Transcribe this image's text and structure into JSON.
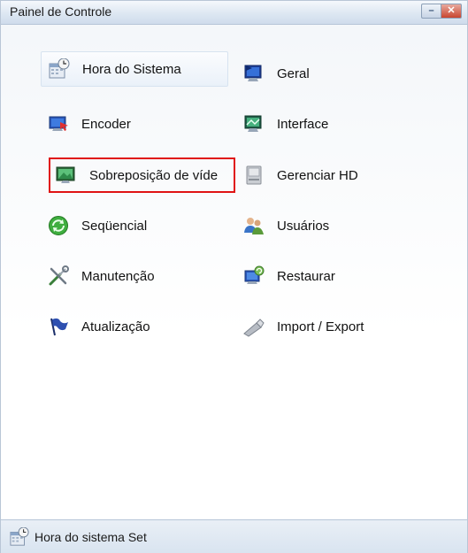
{
  "window": {
    "title": "Painel de Controle",
    "minimize_label": "–",
    "close_label": "✕"
  },
  "menu": {
    "left": [
      {
        "label": "Hora do Sistema",
        "icon": "calendar-clock-icon"
      },
      {
        "label": "Encoder",
        "icon": "monitor-arrow-icon"
      },
      {
        "label": "Sobreposição de víde",
        "icon": "video-overlay-icon"
      },
      {
        "label": "Seqüencial",
        "icon": "sequence-refresh-icon"
      },
      {
        "label": "Manutenção",
        "icon": "tools-icon"
      },
      {
        "label": "Atualização",
        "icon": "flag-icon"
      }
    ],
    "right": [
      {
        "label": "Geral",
        "icon": "monitor-general-icon"
      },
      {
        "label": "Interface",
        "icon": "monitor-interface-icon"
      },
      {
        "label": "Gerenciar HD",
        "icon": "hard-disk-icon"
      },
      {
        "label": "Usuários",
        "icon": "users-icon"
      },
      {
        "label": "Restaurar",
        "icon": "restore-icon"
      },
      {
        "label": "Import / Export",
        "icon": "usb-drive-icon"
      }
    ],
    "hovered": "Hora do Sistema",
    "selected": "Sobreposição de víde"
  },
  "status": {
    "text": "Hora do sistema Set",
    "icon": "calendar-clock-icon"
  }
}
